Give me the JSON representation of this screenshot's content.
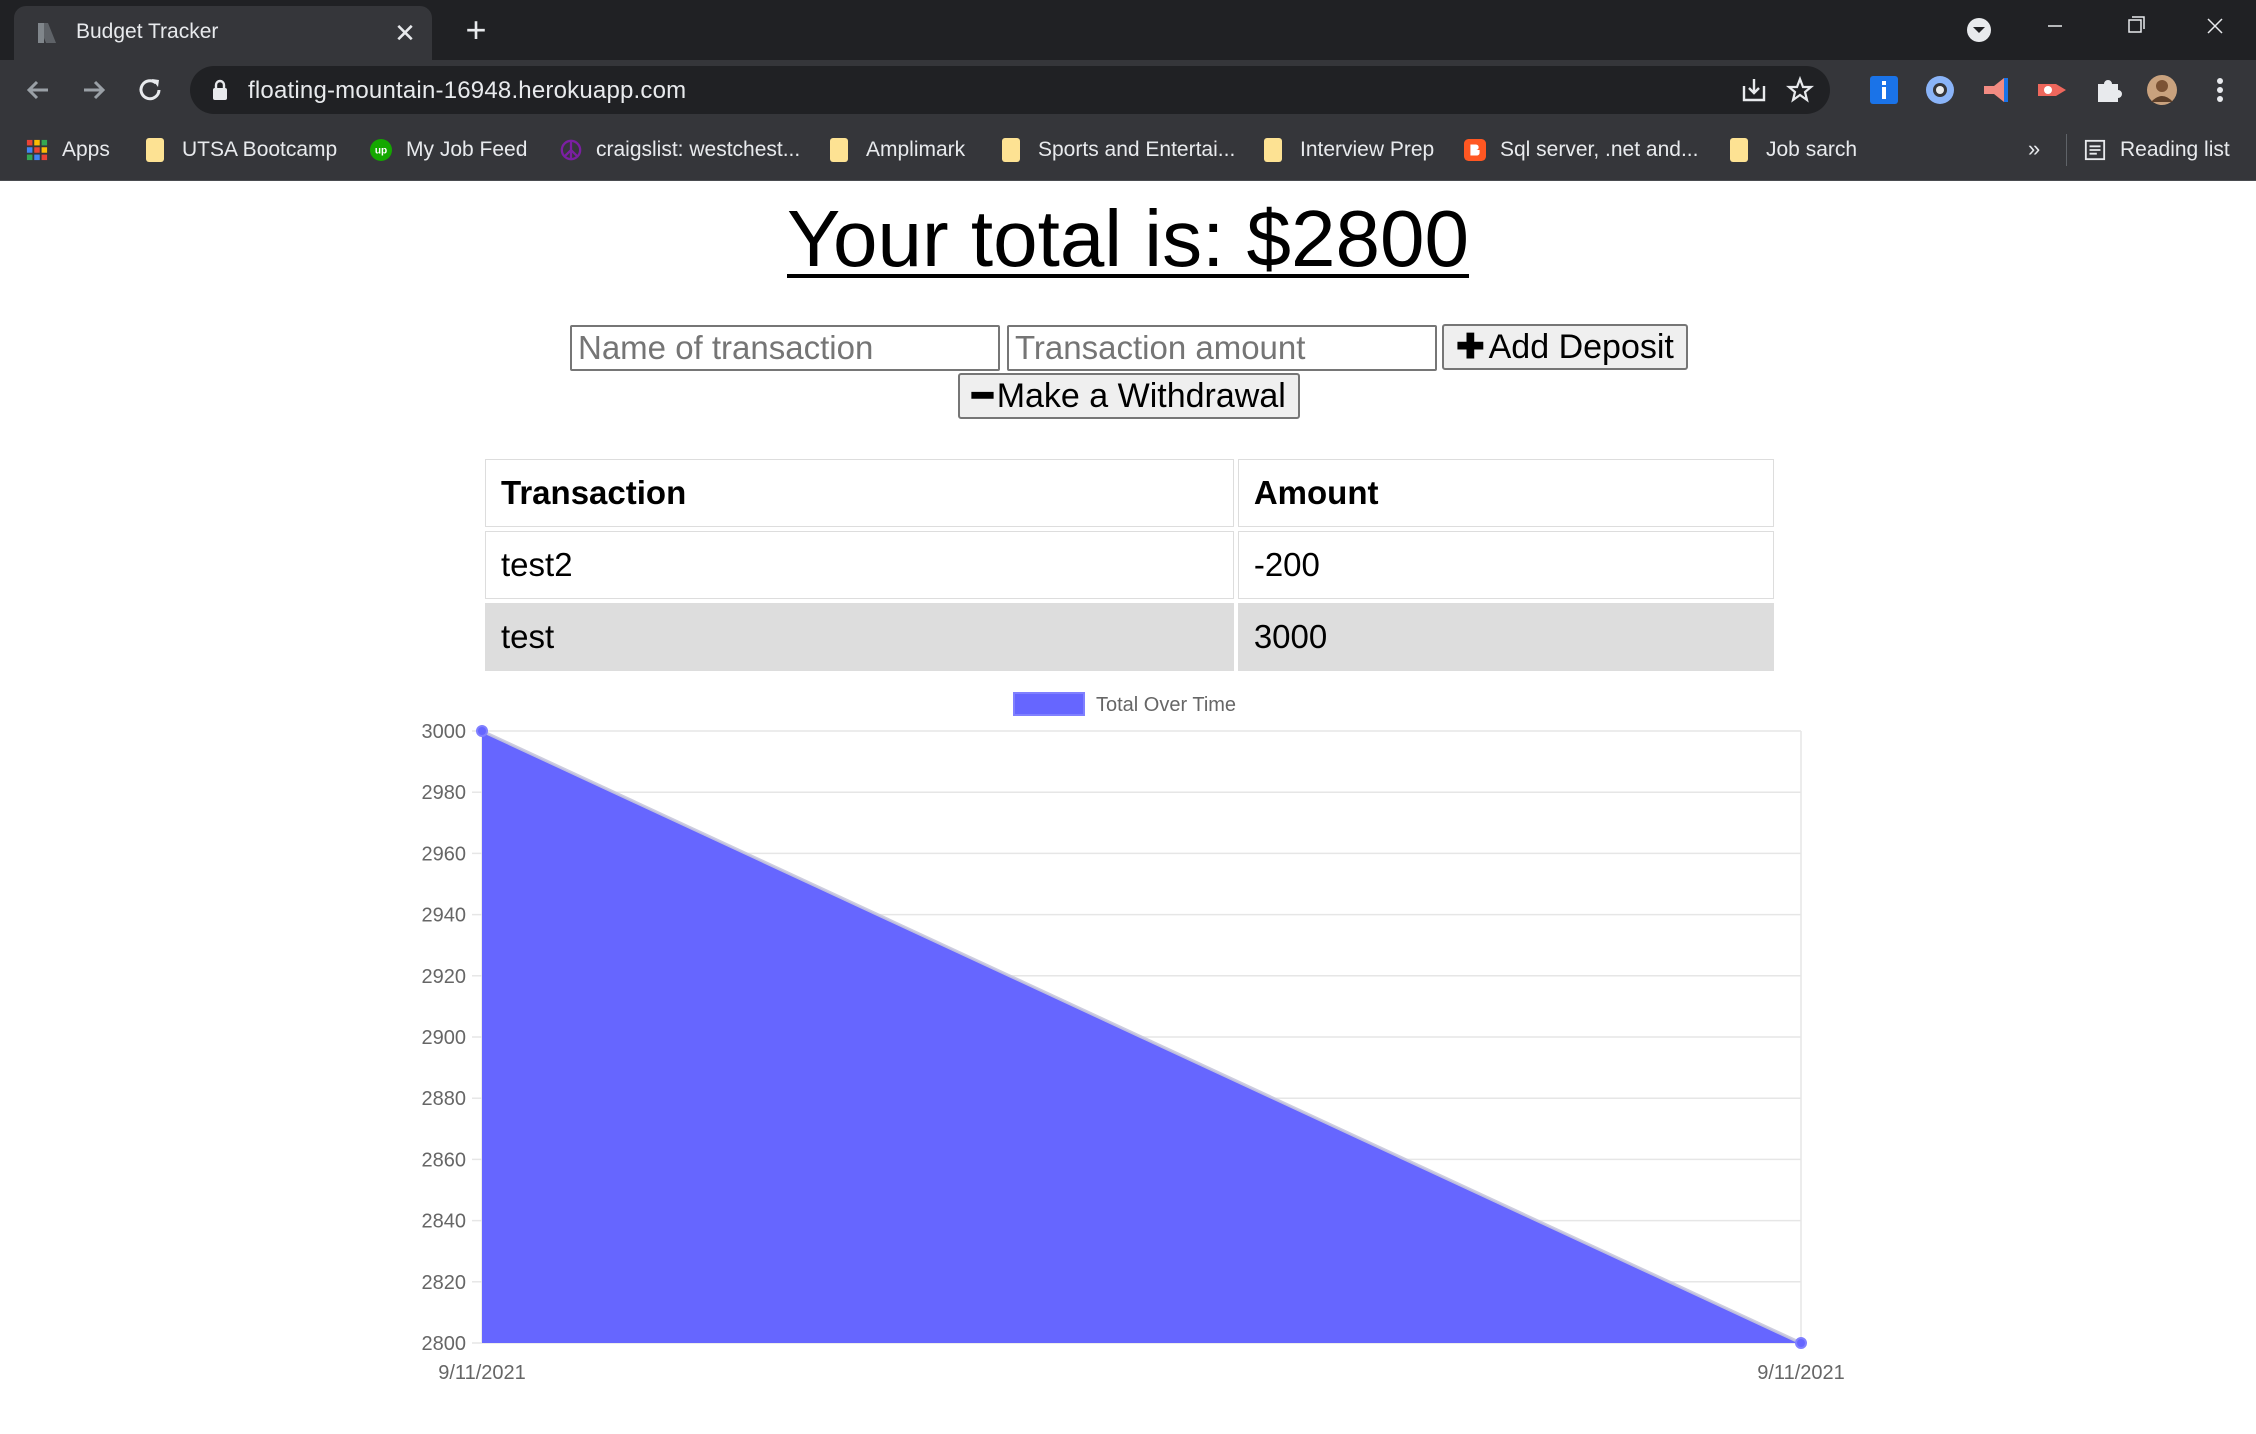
{
  "browser": {
    "tab_title": "Budget Tracker",
    "tab_close_glyph": "✕",
    "new_tab_glyph": "+",
    "url": "floating-mountain-16948.herokuapp.com",
    "bookmarks": [
      {
        "label": "Apps",
        "icon": "apps-grid-icon"
      },
      {
        "label": "UTSA Bootcamp",
        "icon": "folder-icon"
      },
      {
        "label": "My Job Feed",
        "icon": "upwork-icon"
      },
      {
        "label": "craigslist: westchest...",
        "icon": "peace-icon"
      },
      {
        "label": "Amplimark",
        "icon": "folder-icon"
      },
      {
        "label": "Sports and Entertai...",
        "icon": "folder-icon"
      },
      {
        "label": "Interview Prep",
        "icon": "folder-icon"
      },
      {
        "label": "Sql server, .net and...",
        "icon": "blogger-icon"
      },
      {
        "label": "Job sarch",
        "icon": "folder-icon"
      }
    ],
    "bookmarks_overflow": "»",
    "reading_list": "Reading list"
  },
  "page": {
    "total_text": "Your total is: $2800",
    "name_placeholder": "Name of transaction",
    "amount_placeholder": "Transaction amount",
    "add_deposit_label": "Add Deposit",
    "add_deposit_glyph": "✚",
    "withdraw_label": "Make a Withdrawal",
    "withdraw_glyph": "━"
  },
  "table": {
    "headers": [
      "Transaction",
      "Amount"
    ],
    "rows": [
      {
        "name": "test2",
        "amount": "-200"
      },
      {
        "name": "test",
        "amount": "3000"
      }
    ]
  },
  "chart_data": {
    "type": "area",
    "legend": "Total Over Time",
    "x": [
      "9/11/2021",
      "9/11/2021"
    ],
    "series": [
      {
        "name": "Total Over Time",
        "values": [
          3000,
          2800
        ]
      }
    ],
    "ylim": [
      2800,
      3000
    ],
    "yticks": [
      3000,
      2980,
      2960,
      2940,
      2920,
      2900,
      2880,
      2860,
      2840,
      2820,
      2800
    ],
    "fill_color": "#6666ff",
    "grid": true,
    "legend_position": "top"
  },
  "colors": {
    "chrome_dark": "#202124",
    "chrome_toolbar": "#35363a",
    "row_alt": "#dddddd"
  }
}
